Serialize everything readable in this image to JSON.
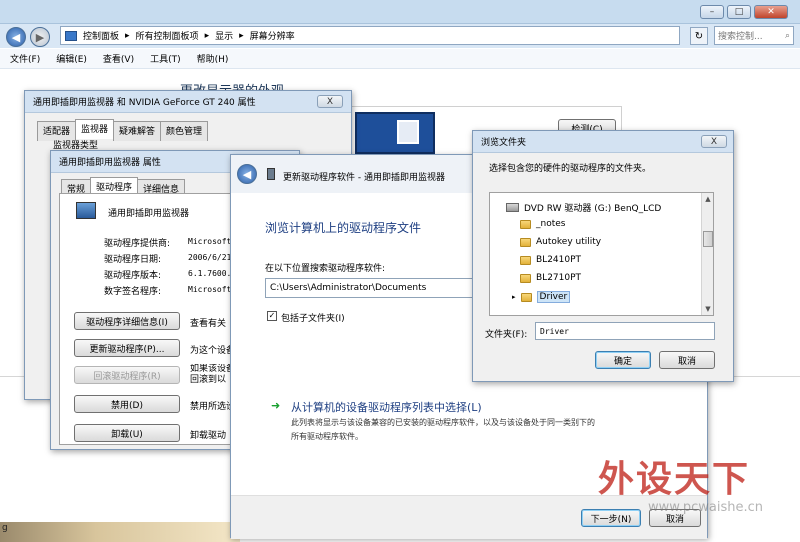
{
  "explorer": {
    "breadcrumb": [
      "控制面板",
      "所有控制面板项",
      "显示",
      "屏幕分辨率"
    ],
    "search_placeholder": "搜索控制...",
    "menu": [
      "文件(F)",
      "编辑(E)",
      "查看(V)",
      "工具(T)",
      "帮助(H)"
    ],
    "heading": "更改显示器的外观",
    "detect_button": "检测(C)"
  },
  "monitor_props": {
    "title": "通用即插即用监视器 和 NVIDIA GeForce GT 240 属性",
    "close": "X",
    "tabs": [
      "适配器",
      "监视器",
      "疑难解答",
      "颜色管理"
    ],
    "active_tab": "监视器",
    "section": "监视器类型"
  },
  "pnp_props": {
    "title": "通用即插即用监视器 属性",
    "tabs": [
      "常规",
      "驱动程序",
      "详细信息"
    ],
    "active_tab": "驱动程序",
    "device_name": "通用即插即用监视器",
    "fields": [
      {
        "label": "驱动程序提供商:",
        "value": "Microsoft"
      },
      {
        "label": "驱动程序日期:",
        "value": "2006/6/21"
      },
      {
        "label": "驱动程序版本:",
        "value": "6.1.7600."
      },
      {
        "label": "数字签名程序:",
        "value": "Microsoft"
      }
    ],
    "buttons": [
      {
        "label": "驱动程序详细信息(I)",
        "desc": "查看有关",
        "enabled": true
      },
      {
        "label": "更新驱动程序(P)...",
        "desc": "为这个设备",
        "enabled": true
      },
      {
        "label": "回滚驱动程序(R)",
        "desc": "如果该设备 回滚到以",
        "enabled": false
      },
      {
        "label": "禁用(D)",
        "desc": "禁用所选设",
        "enabled": true
      },
      {
        "label": "卸载(U)",
        "desc": "卸载驱动",
        "enabled": true
      }
    ]
  },
  "update_wizard": {
    "title": "更新驱动程序软件 - 通用即插即用监视器",
    "heading": "浏览计算机上的驱动程序文件",
    "path_label": "在以下位置搜索驱动程序软件:",
    "path_value": "C:\\Users\\Administrator\\Documents",
    "include_subfolders": "包括子文件夹(I)",
    "include_checked": true,
    "pick_link": "从计算机的设备驱动程序列表中选择(L)",
    "pick_desc_1": "此列表将显示与该设备兼容的已安装的驱动程序软件，以及与该设备处于同一类别下的",
    "pick_desc_2": "所有驱动程序软件。",
    "next_button": "下一步(N)",
    "cancel_button": "取消"
  },
  "browse_folder": {
    "title": "浏览文件夹",
    "close": "X",
    "instruction": "选择包含您的硬件的驱动程序的文件夹。",
    "tree": [
      {
        "label": "DVD RW 驱动器 (G:) BenQ_LCD",
        "type": "drive"
      },
      {
        "label": "_notes",
        "type": "folder"
      },
      {
        "label": "Autokey utility",
        "type": "folder"
      },
      {
        "label": "BL2410PT",
        "type": "folder"
      },
      {
        "label": "BL2710PT",
        "type": "folder"
      },
      {
        "label": "Driver",
        "type": "folder"
      }
    ],
    "folder_label": "文件夹(F):",
    "folder_value": "Driver",
    "ok_button": "确定",
    "cancel_button": "取消"
  },
  "watermark": {
    "brand": "外设天下",
    "url": "www.pcwaishe.cn"
  },
  "taskbar_fragment": "g"
}
